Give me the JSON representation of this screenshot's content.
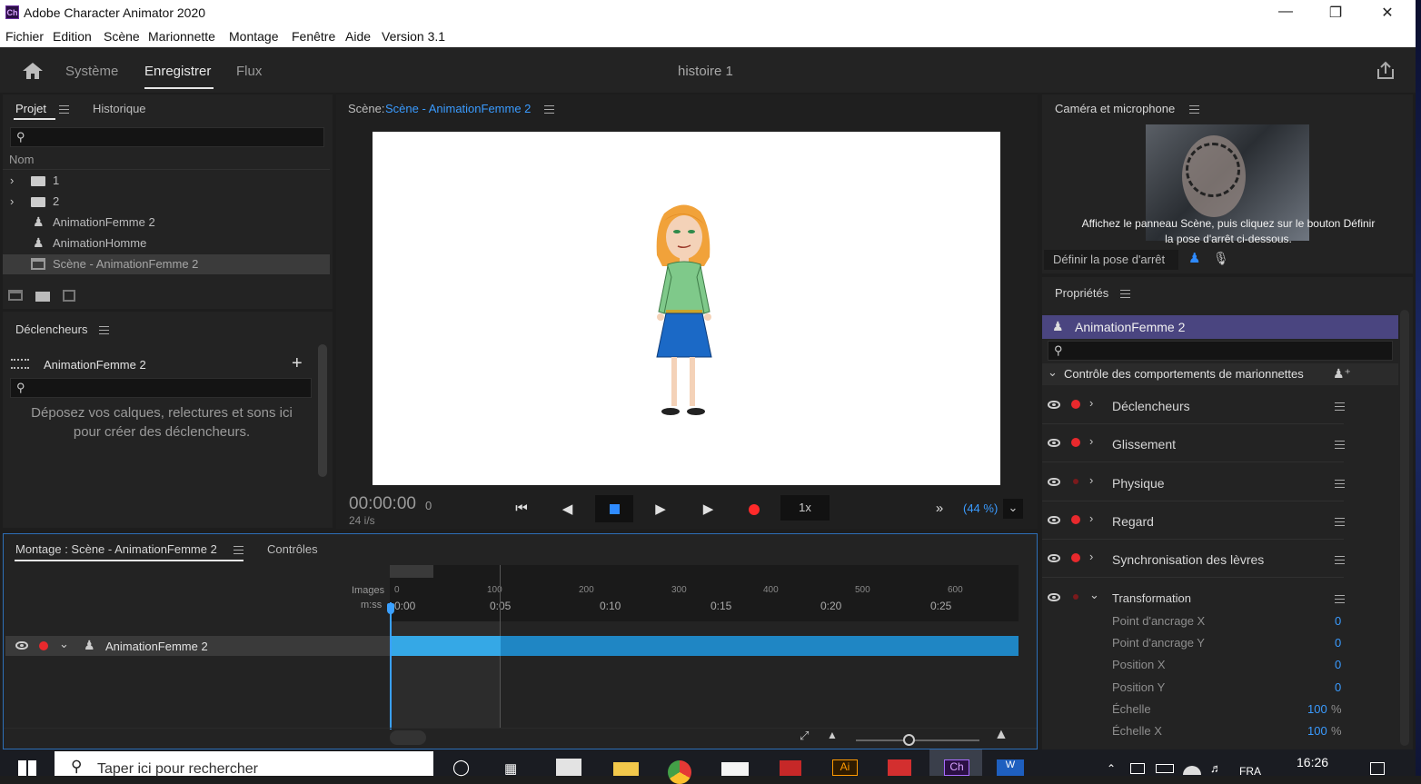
{
  "window": {
    "app_icon": "Ch",
    "title": "Adobe Character Animator 2020",
    "controls": [
      "minimize-icon",
      "restore-icon",
      "close-icon"
    ]
  },
  "menu": [
    "Fichier",
    "Edition",
    "Scène",
    "Marionnette",
    "Montage",
    "Fenêtre",
    "Aide",
    "Version 3.1"
  ],
  "header": {
    "tabs": [
      "Système",
      "Enregistrer",
      "Flux"
    ],
    "active_tab": "Enregistrer",
    "scene_title": "histoire 1"
  },
  "project": {
    "tab": "Projet",
    "tab2": "Historique",
    "column": "Nom",
    "items": [
      {
        "label": "1",
        "kind": "folder"
      },
      {
        "label": "2",
        "kind": "folder"
      },
      {
        "label": "AnimationFemme 2",
        "kind": "puppet"
      },
      {
        "label": "AnimationHomme",
        "kind": "puppet"
      },
      {
        "label": "Scène - AnimationFemme 2",
        "kind": "scene"
      }
    ]
  },
  "triggers": {
    "title": "Déclencheurs",
    "puppet": "AnimationFemme 2",
    "hint": "Déposez vos calques, relectures et sons ici pour créer des déclencheurs."
  },
  "scene": {
    "prefix": "Scène:",
    "name": "Scène - AnimationFemme 2",
    "timecode": "00:00:00",
    "frame": "0",
    "fps": "24 i/s",
    "speed": "1x",
    "zoom": "(44 %)"
  },
  "camera": {
    "title": "Caméra et microphone",
    "message": "Affichez le panneau Scène, puis cliquez sur le bouton Définir la pose d'arrêt ci-dessous.",
    "rest_button": "Définir la pose d'arrêt"
  },
  "properties": {
    "title": "Propriétés",
    "puppet": "AnimationFemme 2",
    "section": "Contrôle des comportements de marionnettes",
    "behaviors": [
      "Déclencheurs",
      "Glissement",
      "Physique",
      "Regard",
      "Synchronisation des lèvres",
      "Transformation"
    ],
    "params": [
      {
        "label": "Point d'ancrage X",
        "value": "0",
        "unit": ""
      },
      {
        "label": "Point d'ancrage Y",
        "value": "0",
        "unit": ""
      },
      {
        "label": "Position X",
        "value": "0",
        "unit": ""
      },
      {
        "label": "Position Y",
        "value": "0",
        "unit": ""
      },
      {
        "label": "Échelle",
        "value": "100",
        "unit": "%"
      },
      {
        "label": "Échelle X",
        "value": "100",
        "unit": "%"
      }
    ]
  },
  "timeline": {
    "tab": "Montage : Scène - AnimationFemme 2",
    "tab2": "Contrôles",
    "row1_label": "Images",
    "row2_label": "m:ss",
    "frames": [
      "0",
      "100",
      "200",
      "300",
      "400",
      "500",
      "600"
    ],
    "times": [
      "0:00",
      "0:05",
      "0:10",
      "0:15",
      "0:20",
      "0:25"
    ],
    "track": "AnimationFemme 2"
  },
  "taskbar": {
    "search": "Taper ici pour rechercher",
    "lang": "FRA",
    "clock": "16:26"
  }
}
